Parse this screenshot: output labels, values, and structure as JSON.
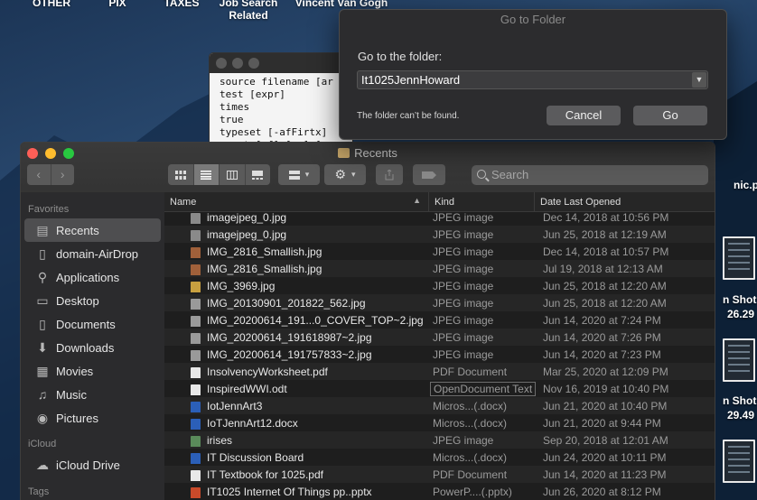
{
  "desktop": {
    "labels": [
      "OTHER",
      "PIX",
      "TAXES",
      "Job Search Related",
      "Vincent Van Gogh"
    ],
    "right_files": [
      "nic.pdf",
      "n Shot",
      "26.29",
      "n Shot",
      "29.49"
    ]
  },
  "terminal": {
    "lines": [
      "source filename [ar",
      "test [expr]",
      "times",
      "true",
      "typeset [-afFirtx]",
      "unset [-f] [-v] [n"
    ]
  },
  "goto": {
    "title": "Go to Folder",
    "prompt": "Go to the folder:",
    "value": "It1025JennHoward",
    "error": "The folder can’t be found.",
    "cancel": "Cancel",
    "go": "Go"
  },
  "finder": {
    "title": "Recents",
    "search_placeholder": "Search",
    "sidebar": {
      "favorites_label": "Favorites",
      "favorites": [
        {
          "label": "Recents",
          "icon": "recents-icon",
          "glyph": "▤",
          "active": true
        },
        {
          "label": "domain-AirDrop",
          "icon": "document-icon",
          "glyph": "▯"
        },
        {
          "label": "Applications",
          "icon": "applications-icon",
          "glyph": "⚲"
        },
        {
          "label": "Desktop",
          "icon": "desktop-icon",
          "glyph": "▭"
        },
        {
          "label": "Documents",
          "icon": "documents-icon",
          "glyph": "▯"
        },
        {
          "label": "Downloads",
          "icon": "downloads-icon",
          "glyph": "⬇"
        },
        {
          "label": "Movies",
          "icon": "movies-icon",
          "glyph": "▦"
        },
        {
          "label": "Music",
          "icon": "music-icon",
          "glyph": "♫"
        },
        {
          "label": "Pictures",
          "icon": "pictures-icon",
          "glyph": "◉"
        }
      ],
      "icloud_label": "iCloud",
      "icloud": [
        {
          "label": "iCloud Drive",
          "icon": "cloud-icon",
          "glyph": "☁"
        }
      ],
      "tags_label": "Tags"
    },
    "columns": {
      "name": "Name",
      "kind": "Kind",
      "date": "Date Last Opened"
    },
    "rows": [
      {
        "name": "imagejpeg_0.jpg",
        "kind": "JPEG image",
        "date": "Dec 14, 2018 at 10:56 PM",
        "icon": "#8a8a8a"
      },
      {
        "name": "imagejpeg_0.jpg",
        "kind": "JPEG image",
        "date": "Jun 25, 2018 at 12:19 AM",
        "icon": "#8a8a8a"
      },
      {
        "name": "IMG_2816_Smallish.jpg",
        "kind": "JPEG image",
        "date": "Dec 14, 2018 at 10:57 PM",
        "icon": "#a0603a"
      },
      {
        "name": "IMG_2816_Smallish.jpg",
        "kind": "JPEG image",
        "date": "Jul 19, 2018 at 12:13 AM",
        "icon": "#a0603a"
      },
      {
        "name": "IMG_3969.jpg",
        "kind": "JPEG image",
        "date": "Jun 25, 2018 at 12:20 AM",
        "icon": "#c8a040"
      },
      {
        "name": "IMG_20130901_201822_562.jpg",
        "kind": "JPEG image",
        "date": "Jun 25, 2018 at 12:20 AM",
        "icon": "#9a9a9a"
      },
      {
        "name": "IMG_20200614_191...0_COVER_TOP~2.jpg",
        "kind": "JPEG image",
        "date": "Jun 14, 2020 at 7:24 PM",
        "icon": "#9a9a9a"
      },
      {
        "name": "IMG_20200614_191618987~2.jpg",
        "kind": "JPEG image",
        "date": "Jun 14, 2020 at 7:26 PM",
        "icon": "#9a9a9a"
      },
      {
        "name": "IMG_20200614_191757833~2.jpg",
        "kind": "JPEG image",
        "date": "Jun 14, 2020 at 7:23 PM",
        "icon": "#9a9a9a"
      },
      {
        "name": "InsolvencyWorksheet.pdf",
        "kind": "PDF Document",
        "date": "Mar 25, 2020 at 12:09 PM",
        "icon": "#e8e8e8"
      },
      {
        "name": "InspiredWWI.odt",
        "kind": "OpenDocument Text",
        "date": "Nov 16, 2019 at 10:40 PM",
        "icon": "#e8e8e8"
      },
      {
        "name": "IotJennArt3",
        "kind": "Micros...(.docx)",
        "date": "Jun 21, 2020 at 10:40 PM",
        "icon": "#2b5fb8"
      },
      {
        "name": "IoTJennArt12.docx",
        "kind": "Micros...(.docx)",
        "date": "Jun 21, 2020 at 9:44 PM",
        "icon": "#2b5fb8"
      },
      {
        "name": "irises",
        "kind": "JPEG image",
        "date": "Sep 20, 2018 at 12:01 AM",
        "icon": "#5a8a5a"
      },
      {
        "name": "IT Discussion Board",
        "kind": "Micros...(.docx)",
        "date": "Jun 24, 2020 at 10:11 PM",
        "icon": "#2b5fb8"
      },
      {
        "name": "IT Textbook for 1025.pdf",
        "kind": "PDF Document",
        "date": "Jun 14, 2020 at 11:23 PM",
        "icon": "#e8e8e8"
      },
      {
        "name": "IT1025 Internet Of Things pp..pptx",
        "kind": "PowerP....(.pptx)",
        "date": "Jun 26, 2020 at 8:12 PM",
        "icon": "#c84a2a"
      }
    ]
  }
}
